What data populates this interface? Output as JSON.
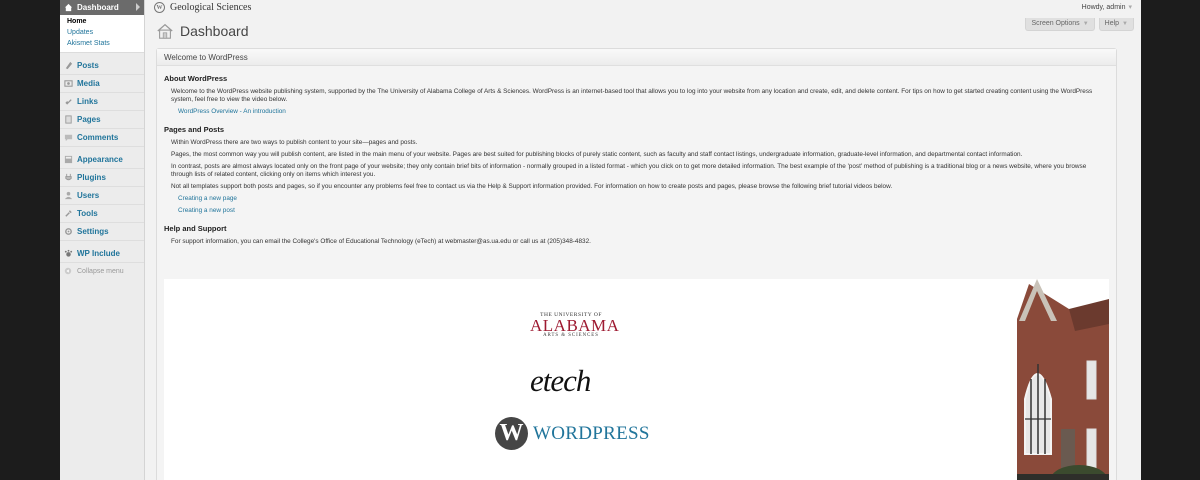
{
  "admin_menu": {
    "dashboard_label": "Dashboard",
    "dashboard_sub": [
      "Home",
      "Updates",
      "Akismet Stats"
    ],
    "items": [
      {
        "label": "Posts",
        "icon": "posts-icon"
      },
      {
        "label": "Media",
        "icon": "media-icon"
      },
      {
        "label": "Links",
        "icon": "links-icon"
      },
      {
        "label": "Pages",
        "icon": "pages-icon"
      },
      {
        "label": "Comments",
        "icon": "comments-icon"
      },
      {
        "label": "Appearance",
        "icon": "appearance-icon"
      },
      {
        "label": "Plugins",
        "icon": "plugins-icon"
      },
      {
        "label": "Users",
        "icon": "users-icon"
      },
      {
        "label": "Tools",
        "icon": "tools-icon"
      },
      {
        "label": "Settings",
        "icon": "settings-icon"
      },
      {
        "label": "WP Include",
        "icon": "wp-include-icon"
      }
    ],
    "collapse_label": "Collapse menu"
  },
  "header": {
    "site_name": "Geological Sciences",
    "howdy": "Howdy, admin",
    "page_title": "Dashboard",
    "screen_options": "Screen Options",
    "help": "Help"
  },
  "widget": {
    "title": "Welcome to WordPress",
    "about_title": "About WordPress",
    "about_text": "Welcome to the WordPress website publishing system, supported by the The University of Alabama College of Arts & Sciences. WordPress is an internet-based tool that allows you to log into your website from any location and create, edit, and delete content. For tips on how to get started creating content using the WordPress system, feel free to view the video below.",
    "about_link": "WordPress Overview - An introduction",
    "pages_title": "Pages and Posts",
    "pages_p1": "Within WordPress there are two ways to publish content to your site—pages and posts.",
    "pages_p2": "Pages, the most common way you will publish content, are listed in the main menu of your website. Pages are best suited for publishing blocks of purely static content, such as faculty and staff contact listings, undergraduate information, graduate-level information, and departmental contact information.",
    "pages_p3": "In contrast, posts are almost always located only on the front page of your website; they only contain brief bits of information - normally grouped in a listed format - which you click on to get more detailed information. The best example of the 'post' method of publishing is a traditional blog or a news website, where you browse through lists of related content, clicking only on items which interest you.",
    "pages_p4": "Not all templates support both posts and pages, so if you encounter any problems feel free to contact us via the Help & Support information provided. For information on how to create posts and pages, please browse the following brief tutorial videos below.",
    "link_page": "Creating a new page",
    "link_post": "Creating a new post",
    "help_title": "Help and Support",
    "help_text": "For support information, you can email the College's Office of Educational Technology (eTech) at webmaster@as.ua.edu or call us at (205)348-4832."
  },
  "banner": {
    "ua_top": "THE UNIVERSITY OF",
    "ua_main": "ALABAMA",
    "ua_sub": "ARTS & SCIENCES",
    "etech": "etech",
    "wp_mark": "W",
    "wp_word": "WORDPRESS"
  },
  "colors": {
    "link": "#21759b",
    "alabama_crimson": "#9e1b32",
    "current_menu_bg": "#6b6b6b"
  }
}
